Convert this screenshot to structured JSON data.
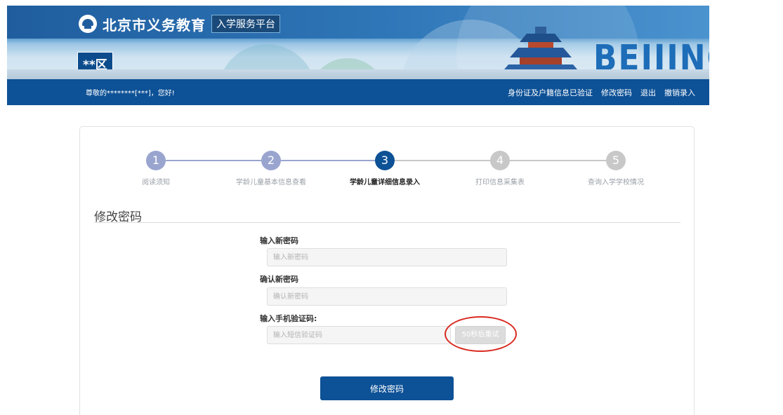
{
  "header": {
    "site_title": "北京市义务教育",
    "site_subtitle": "入学服务平台",
    "district": "**区",
    "banner_text": "BEIJING"
  },
  "navbar": {
    "greeting": "尊敬的********[***]，您好!",
    "links": [
      "身份证及户籍信息已验证",
      "修改密码",
      "退出",
      "撤销录入"
    ]
  },
  "steps": [
    {
      "number": "1",
      "label": "阅读须知"
    },
    {
      "number": "2",
      "label": "学龄儿童基本信息查看"
    },
    {
      "number": "3",
      "label": "学龄儿童详细信息录入"
    },
    {
      "number": "4",
      "label": "打印信息采集表"
    },
    {
      "number": "5",
      "label": "查询入学学校情况"
    }
  ],
  "active_step": 3,
  "colors": {
    "brand_blue": "#0d5196",
    "step_done": "#9aa5cf",
    "step_active": "#0d5196",
    "step_todo": "#c8c8c8",
    "annotation_red": "#d92a20"
  },
  "form": {
    "title": "修改密码",
    "new_password": {
      "label": "输入新密码",
      "placeholder": "输入新密码"
    },
    "confirm_password": {
      "label": "确认新密码",
      "placeholder": "确认新密码"
    },
    "sms_code": {
      "label": "输入手机验证码:",
      "placeholder": "输入短信验证码"
    },
    "retry_button": "50秒后重试",
    "submit_button": "修改密码"
  }
}
